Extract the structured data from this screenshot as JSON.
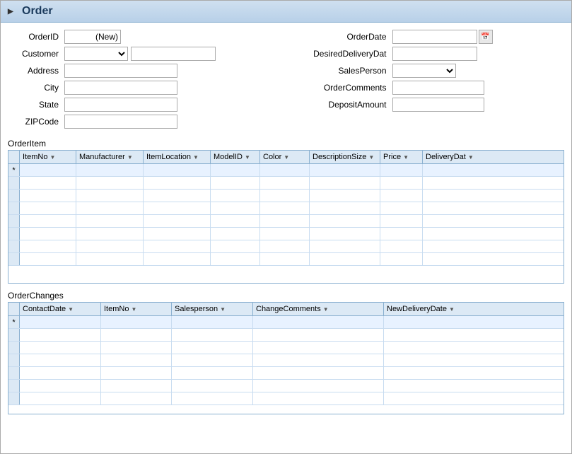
{
  "window": {
    "title": "Order"
  },
  "form": {
    "left": {
      "orderid_label": "OrderID",
      "orderid_value": "(New)",
      "customer_label": "Customer",
      "address_label": "Address",
      "city_label": "City",
      "state_label": "State",
      "zipcode_label": "ZIPCode"
    },
    "right": {
      "orderdate_label": "OrderDate",
      "desireddelivery_label": "DesiredDeliveryDat",
      "salesperson_label": "SalesPerson",
      "ordercomments_label": "OrderComments",
      "depositamount_label": "DepositAmount"
    }
  },
  "orderitem": {
    "section_label": "OrderItem",
    "columns": [
      {
        "key": "itemno",
        "label": "ItemNo"
      },
      {
        "key": "manufacturer",
        "label": "Manufacturer"
      },
      {
        "key": "itemlocation",
        "label": "ItemLocation"
      },
      {
        "key": "modelid",
        "label": "ModelID"
      },
      {
        "key": "color",
        "label": "Color"
      },
      {
        "key": "descsize",
        "label": "DescriptionSize"
      },
      {
        "key": "price",
        "label": "Price"
      },
      {
        "key": "deliverydate",
        "label": "DeliveryDat"
      }
    ]
  },
  "orderchanges": {
    "section_label": "OrderChanges",
    "columns": [
      {
        "key": "contactdate",
        "label": "ContactDate"
      },
      {
        "key": "itemno",
        "label": "ItemNo"
      },
      {
        "key": "salesperson",
        "label": "Salesperson"
      },
      {
        "key": "changecomments",
        "label": "ChangeComments"
      },
      {
        "key": "newdeliverydate",
        "label": "NewDeliveryDate"
      }
    ]
  },
  "icons": {
    "calendar": "📅",
    "dropdown": "▼",
    "nav_arrow": "▶"
  }
}
